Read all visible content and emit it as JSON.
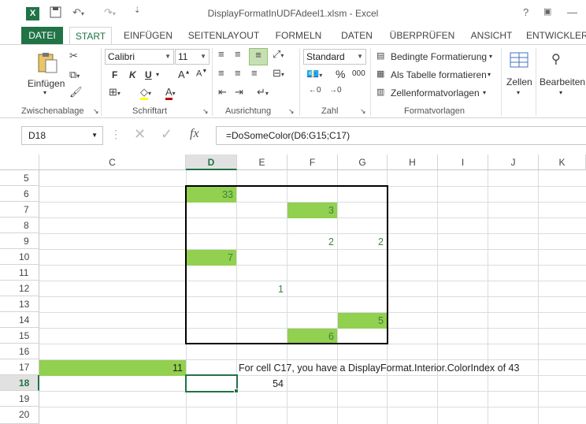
{
  "window": {
    "title": "DisplayFormatInUDFAdeel1.xlsm - Excel",
    "help": "?"
  },
  "tabs": [
    "DATEI",
    "START",
    "EINFÜGEN",
    "SEITENLAYOUT",
    "FORMELN",
    "DATEN",
    "ÜBERPRÜFEN",
    "ANSICHT",
    "ENTWICKLER"
  ],
  "ribbon": {
    "paste_label": "Einfügen",
    "clipboard_group": "Zwischenablage",
    "font_name": "Calibri",
    "font_size": "11",
    "bold": "F",
    "italic": "K",
    "underline": "U",
    "font_group": "Schriftart",
    "alignment_group": "Ausrichtung",
    "number_format": "Standard",
    "percent": "%",
    "thousands": "000",
    "number_group": "Zahl",
    "cond_format": "Bedingte Formatierung",
    "as_table": "Als Tabelle formatieren",
    "cell_styles": "Zellenformatvorlagen",
    "styles_group": "Formatvorlagen",
    "cells_label": "Zellen",
    "edit_label": "Bearbeiten"
  },
  "formula_bar": {
    "name_box": "D18",
    "fx": "fx",
    "formula": "=DoSomeColor(D6:G15;C17)"
  },
  "sheet": {
    "columns": [
      "C",
      "D",
      "E",
      "F",
      "G",
      "H",
      "I",
      "J",
      "K"
    ],
    "rows": [
      "5",
      "6",
      "7",
      "8",
      "9",
      "10",
      "11",
      "12",
      "13",
      "14",
      "15",
      "16",
      "17",
      "18",
      "19",
      "20"
    ],
    "cells": {
      "D6": "33",
      "F7": "3",
      "F9": "2",
      "G9": "2",
      "D10": "7",
      "E12": "1",
      "G14": "5",
      "F15": "6",
      "C17": "11",
      "E17": "For cell C17, you have a DisplayFormat.Interior.ColorIndex of  43",
      "E18": "54"
    },
    "highlight_color": "#92d050",
    "accent_color": "#217346"
  }
}
